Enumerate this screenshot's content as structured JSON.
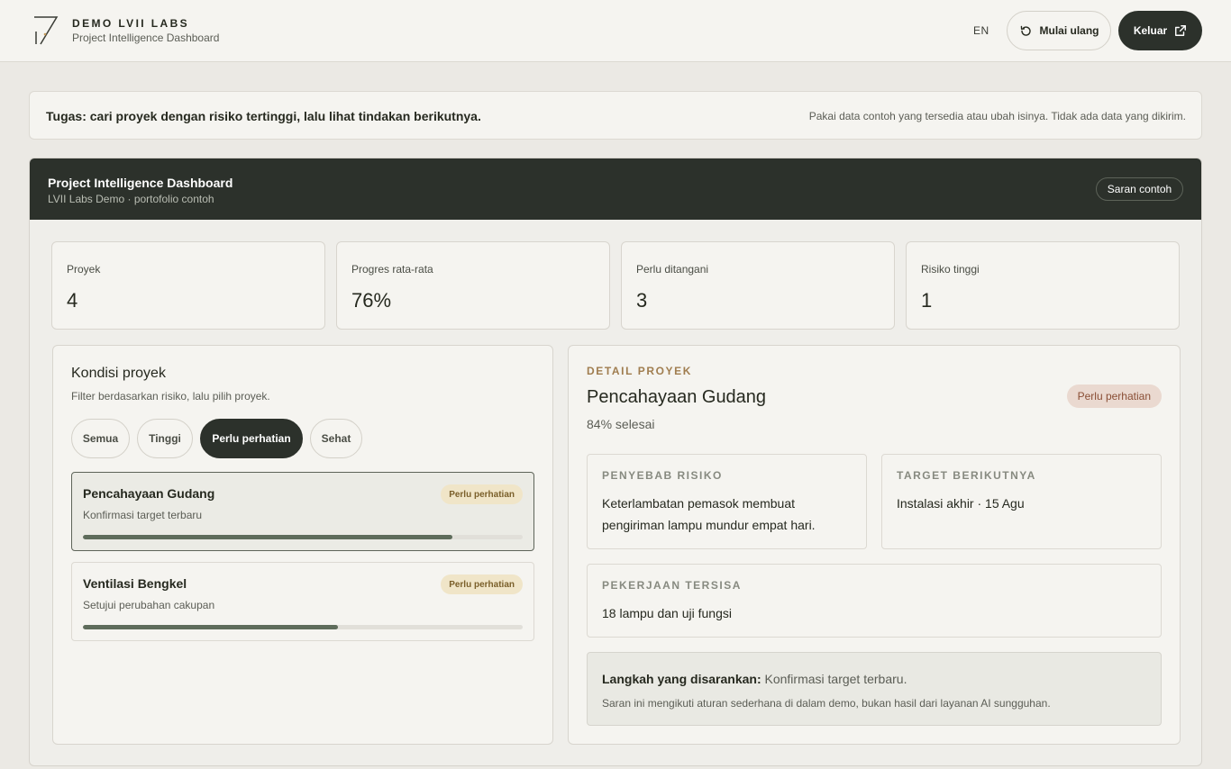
{
  "header": {
    "brand_name": "DEMO LVII LABS",
    "brand_sub": "Project Intelligence Dashboard",
    "language": "EN",
    "restart_label": "Mulai ulang",
    "logout_label": "Keluar"
  },
  "task": {
    "text": "Tugas: cari proyek dengan risiko tertinggi, lalu lihat tindakan berikutnya.",
    "note": "Pakai data contoh yang tersedia atau ubah isinya. Tidak ada data yang dikirim."
  },
  "dashboard": {
    "title": "Project Intelligence Dashboard",
    "subtitle": "LVII Labs Demo · portofolio contoh",
    "sample_button": "Saran contoh"
  },
  "stats": [
    {
      "label": "Proyek",
      "value": "4"
    },
    {
      "label": "Progres rata-rata",
      "value": "76%"
    },
    {
      "label": "Perlu ditangani",
      "value": "3"
    },
    {
      "label": "Risiko tinggi",
      "value": "1"
    }
  ],
  "conditions": {
    "title": "Kondisi proyek",
    "subtitle": "Filter berdasarkan risiko, lalu pilih proyek.",
    "filters": [
      {
        "label": "Semua",
        "active": false
      },
      {
        "label": "Tinggi",
        "active": false
      },
      {
        "label": "Perlu perhatian",
        "active": true
      },
      {
        "label": "Sehat",
        "active": false
      }
    ],
    "projects": [
      {
        "name": "Pencahayaan Gudang",
        "note": "Konfirmasi target terbaru",
        "badge": "Perlu perhatian",
        "progress": 0.84,
        "selected": true
      },
      {
        "name": "Ventilasi Bengkel",
        "note": "Setujui perubahan cakupan",
        "badge": "Perlu perhatian",
        "progress": 0.58,
        "selected": false
      }
    ]
  },
  "detail": {
    "eyebrow": "DETAIL PROYEK",
    "name": "Pencahayaan Gudang",
    "progress_text": "84% selesai",
    "status_badge": "Perlu perhatian",
    "risk_label": "PENYEBAB RISIKO",
    "risk_text": "Keterlambatan pemasok membuat pengiriman lampu mundur empat hari.",
    "target_label": "TARGET BERIKUTNYA",
    "target_text": "Instalasi akhir · 15 Agu",
    "remaining_label": "PEKERJAAN TERSISA",
    "remaining_text": "18 lampu dan uji fungsi",
    "suggest_label": "Langkah yang disarankan:",
    "suggest_text": "Konfirmasi target terbaru.",
    "suggest_note": "Saran ini mengikuti aturan sederhana di dalam demo, bukan hasil dari layanan AI sungguhan."
  },
  "colors": {
    "dark_header": "#2c312b",
    "progress_fill": "#5e6c5b",
    "eyebrow_accent": "#a07d4f",
    "warn_badge_bg": "#f0e5c8",
    "attention_badge_bg": "#ead9d0"
  },
  "icons": {
    "logo": "lvii-logo",
    "restart": "restart-icon",
    "logout": "external-link-icon"
  }
}
